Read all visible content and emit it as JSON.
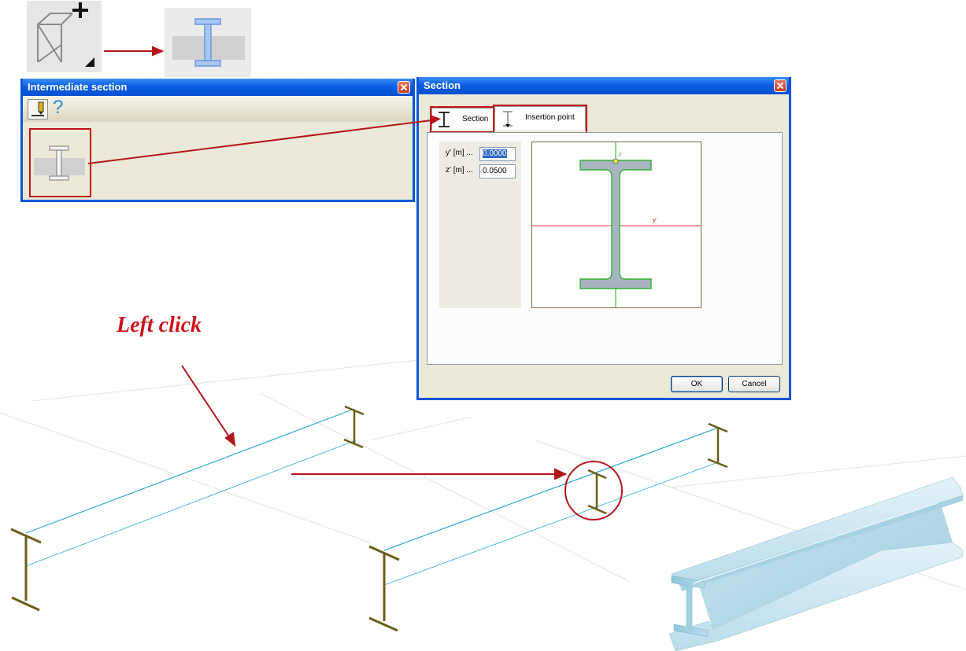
{
  "toolbar": {
    "add_section_icon": "frame-plus-icon",
    "intermediate_section_icon": "i-beam-section-icon"
  },
  "intermediate_dialog": {
    "title": "Intermediate section",
    "help_symbol": "?",
    "section_tool_icon": "i-beam-icon"
  },
  "section_dialog": {
    "title": "Section",
    "tabs": [
      {
        "label": "Section"
      },
      {
        "label": "Insertion point"
      }
    ],
    "fields": [
      {
        "label": "y' [m] ...",
        "value": "0.0000"
      },
      {
        "label": "z' [m] ...",
        "value": "0.0500"
      }
    ],
    "axis_y_label": "y",
    "axis_z_label": "z",
    "ok_label": "OK",
    "cancel_label": "Cancel"
  },
  "annotation": {
    "text": "Left click",
    "color": "#d0121a"
  },
  "colors": {
    "xp_title_blue": "#0a5ee3",
    "highlight_red": "#c0141a",
    "beam_line": "#29a9d0",
    "section_olive": "#6b5d18"
  }
}
